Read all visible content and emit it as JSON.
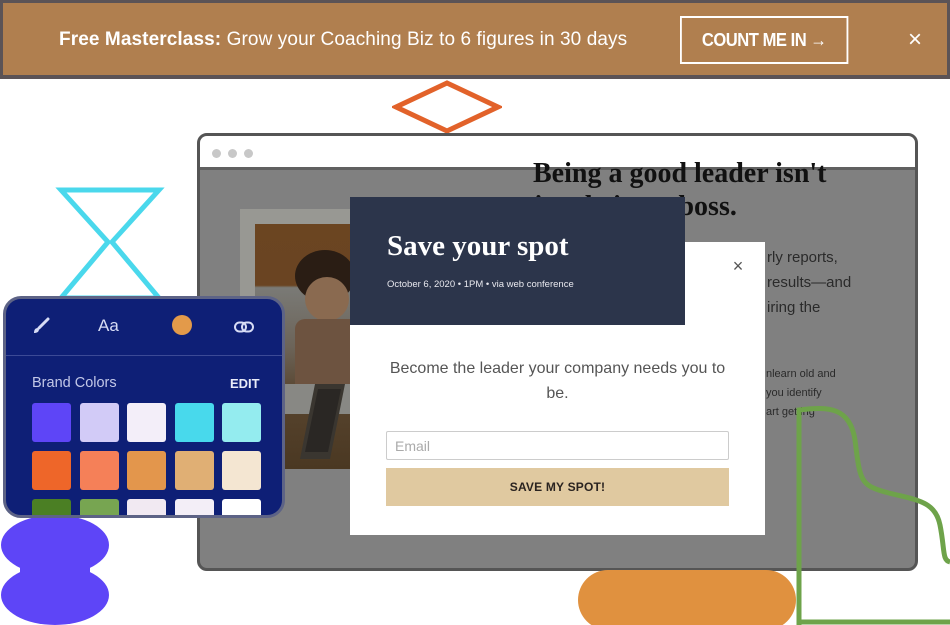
{
  "banner": {
    "bold_text": "Free Masterclass:",
    "text": " Grow your Coaching Biz to 6 figures in 30 days",
    "cta_label": "COUNT ME IN →",
    "close_icon": "×",
    "background": "#b07f4f"
  },
  "browser": {
    "background_page": {
      "heading_line1": "Being a good leader isn't",
      "heading_line2": "just being a boss.",
      "paragraph_lines": [
        "rly reports,",
        "results—and",
        "iring the"
      ],
      "small_lines": [
        "nlearn old and",
        "you identify",
        "art getting"
      ]
    }
  },
  "modal": {
    "title": "Save your spot",
    "subtitle": "October 6, 2020 • 1PM • via web conference",
    "close_icon": "×",
    "copy": "Become the leader your company needs you to be.",
    "email_placeholder": "Email",
    "email_value": "",
    "submit_label": "SAVE MY SPOT!",
    "header_color": "#2c354b",
    "button_color": "#e0c9a0"
  },
  "brand_panel": {
    "tools": [
      {
        "icon": "paintbrush-icon"
      },
      {
        "icon": "font-icon",
        "label": "Aa"
      },
      {
        "icon": "color-picker-icon",
        "color": "#e39a4a"
      },
      {
        "icon": "link-icon"
      }
    ],
    "title": "Brand Colors",
    "edit_label": "EDIT",
    "swatches": [
      [
        "#5e45f7",
        "#d2cbf7",
        "#f3eef9",
        "#48d9ec",
        "#94ecef"
      ],
      [
        "#ee6629",
        "#f58058",
        "#e3964c",
        "#e0af74",
        "#f4e6d2"
      ],
      [
        "#4b7f24",
        "#77a551",
        "#f1e9f2",
        "#f3eef7",
        "#ffffff"
      ]
    ]
  },
  "decorations": {
    "orange_diamond": "#e2622a",
    "cyan_hourglass": "#4ad8ec",
    "purple_blob": "#5e45f7",
    "orange_pill": "#e0913f",
    "green_line": "#6ea34a"
  }
}
